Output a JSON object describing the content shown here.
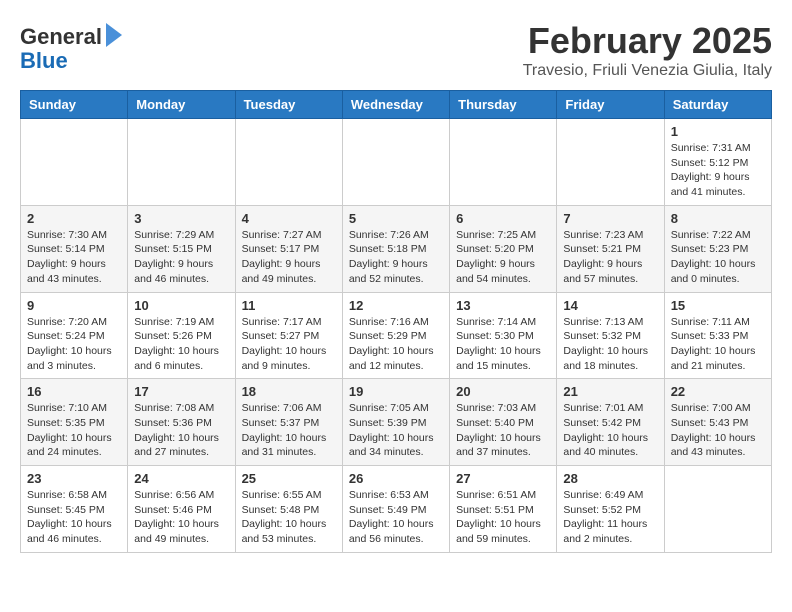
{
  "header": {
    "logo_line1": "General",
    "logo_line2": "Blue",
    "month": "February 2025",
    "location": "Travesio, Friuli Venezia Giulia, Italy"
  },
  "weekdays": [
    "Sunday",
    "Monday",
    "Tuesday",
    "Wednesday",
    "Thursday",
    "Friday",
    "Saturday"
  ],
  "weeks": [
    [
      {
        "day": "",
        "info": ""
      },
      {
        "day": "",
        "info": ""
      },
      {
        "day": "",
        "info": ""
      },
      {
        "day": "",
        "info": ""
      },
      {
        "day": "",
        "info": ""
      },
      {
        "day": "",
        "info": ""
      },
      {
        "day": "1",
        "info": "Sunrise: 7:31 AM\nSunset: 5:12 PM\nDaylight: 9 hours and 41 minutes."
      }
    ],
    [
      {
        "day": "2",
        "info": "Sunrise: 7:30 AM\nSunset: 5:14 PM\nDaylight: 9 hours and 43 minutes."
      },
      {
        "day": "3",
        "info": "Sunrise: 7:29 AM\nSunset: 5:15 PM\nDaylight: 9 hours and 46 minutes."
      },
      {
        "day": "4",
        "info": "Sunrise: 7:27 AM\nSunset: 5:17 PM\nDaylight: 9 hours and 49 minutes."
      },
      {
        "day": "5",
        "info": "Sunrise: 7:26 AM\nSunset: 5:18 PM\nDaylight: 9 hours and 52 minutes."
      },
      {
        "day": "6",
        "info": "Sunrise: 7:25 AM\nSunset: 5:20 PM\nDaylight: 9 hours and 54 minutes."
      },
      {
        "day": "7",
        "info": "Sunrise: 7:23 AM\nSunset: 5:21 PM\nDaylight: 9 hours and 57 minutes."
      },
      {
        "day": "8",
        "info": "Sunrise: 7:22 AM\nSunset: 5:23 PM\nDaylight: 10 hours and 0 minutes."
      }
    ],
    [
      {
        "day": "9",
        "info": "Sunrise: 7:20 AM\nSunset: 5:24 PM\nDaylight: 10 hours and 3 minutes."
      },
      {
        "day": "10",
        "info": "Sunrise: 7:19 AM\nSunset: 5:26 PM\nDaylight: 10 hours and 6 minutes."
      },
      {
        "day": "11",
        "info": "Sunrise: 7:17 AM\nSunset: 5:27 PM\nDaylight: 10 hours and 9 minutes."
      },
      {
        "day": "12",
        "info": "Sunrise: 7:16 AM\nSunset: 5:29 PM\nDaylight: 10 hours and 12 minutes."
      },
      {
        "day": "13",
        "info": "Sunrise: 7:14 AM\nSunset: 5:30 PM\nDaylight: 10 hours and 15 minutes."
      },
      {
        "day": "14",
        "info": "Sunrise: 7:13 AM\nSunset: 5:32 PM\nDaylight: 10 hours and 18 minutes."
      },
      {
        "day": "15",
        "info": "Sunrise: 7:11 AM\nSunset: 5:33 PM\nDaylight: 10 hours and 21 minutes."
      }
    ],
    [
      {
        "day": "16",
        "info": "Sunrise: 7:10 AM\nSunset: 5:35 PM\nDaylight: 10 hours and 24 minutes."
      },
      {
        "day": "17",
        "info": "Sunrise: 7:08 AM\nSunset: 5:36 PM\nDaylight: 10 hours and 27 minutes."
      },
      {
        "day": "18",
        "info": "Sunrise: 7:06 AM\nSunset: 5:37 PM\nDaylight: 10 hours and 31 minutes."
      },
      {
        "day": "19",
        "info": "Sunrise: 7:05 AM\nSunset: 5:39 PM\nDaylight: 10 hours and 34 minutes."
      },
      {
        "day": "20",
        "info": "Sunrise: 7:03 AM\nSunset: 5:40 PM\nDaylight: 10 hours and 37 minutes."
      },
      {
        "day": "21",
        "info": "Sunrise: 7:01 AM\nSunset: 5:42 PM\nDaylight: 10 hours and 40 minutes."
      },
      {
        "day": "22",
        "info": "Sunrise: 7:00 AM\nSunset: 5:43 PM\nDaylight: 10 hours and 43 minutes."
      }
    ],
    [
      {
        "day": "23",
        "info": "Sunrise: 6:58 AM\nSunset: 5:45 PM\nDaylight: 10 hours and 46 minutes."
      },
      {
        "day": "24",
        "info": "Sunrise: 6:56 AM\nSunset: 5:46 PM\nDaylight: 10 hours and 49 minutes."
      },
      {
        "day": "25",
        "info": "Sunrise: 6:55 AM\nSunset: 5:48 PM\nDaylight: 10 hours and 53 minutes."
      },
      {
        "day": "26",
        "info": "Sunrise: 6:53 AM\nSunset: 5:49 PM\nDaylight: 10 hours and 56 minutes."
      },
      {
        "day": "27",
        "info": "Sunrise: 6:51 AM\nSunset: 5:51 PM\nDaylight: 10 hours and 59 minutes."
      },
      {
        "day": "28",
        "info": "Sunrise: 6:49 AM\nSunset: 5:52 PM\nDaylight: 11 hours and 2 minutes."
      },
      {
        "day": "",
        "info": ""
      }
    ]
  ]
}
